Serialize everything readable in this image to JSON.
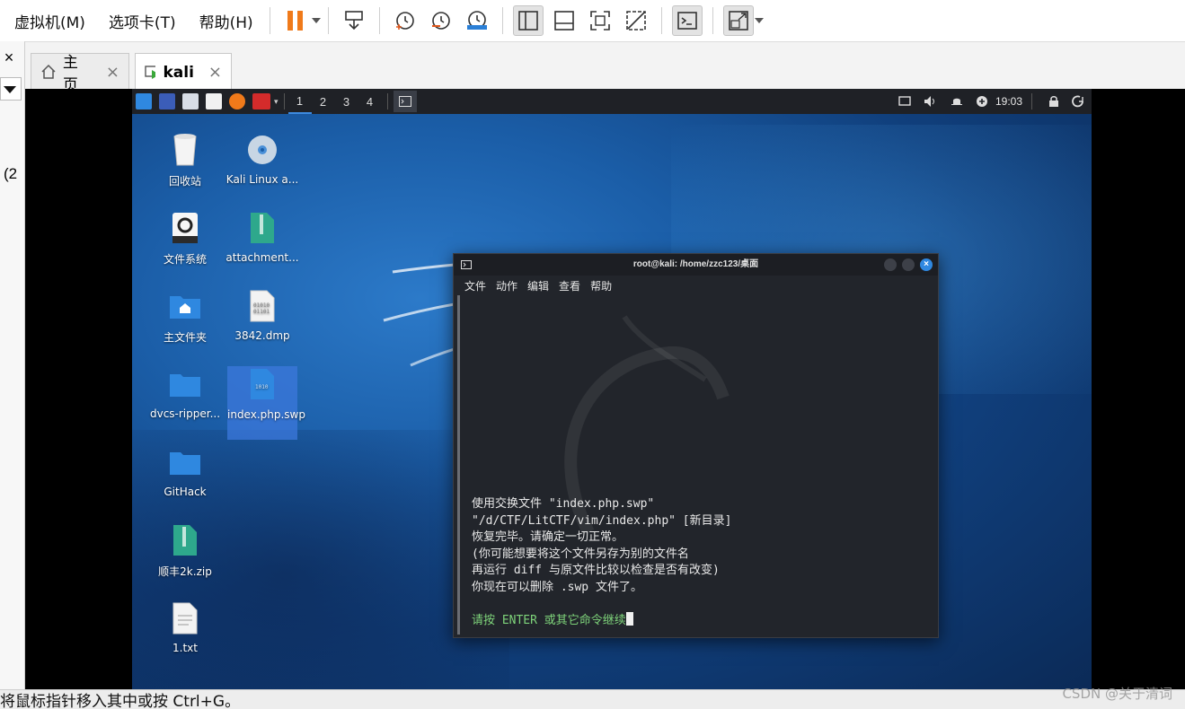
{
  "menubar": {
    "items": [
      "虚拟机(M)",
      "选项卡(T)",
      "帮助(H)"
    ]
  },
  "tabs": [
    {
      "label": "主页",
      "close": "×"
    },
    {
      "label": "kali",
      "close": "×"
    }
  ],
  "left_panel": {
    "close": "×",
    "partial": "(2"
  },
  "kali_panel": {
    "workspaces": [
      "1",
      "2",
      "3",
      "4"
    ],
    "clock": "19:03"
  },
  "desktop_icons": [
    {
      "label": "回收站"
    },
    {
      "label": "Kali Linux a..."
    },
    {
      "label": "文件系统"
    },
    {
      "label": "attachment..."
    },
    {
      "label": "主文件夹"
    },
    {
      "label": "3842.dmp"
    },
    {
      "label": "dvcs-ripper..."
    },
    {
      "label": "index.php.swp"
    },
    {
      "label": "GitHack"
    },
    {
      "label": "顺丰2k.zip"
    },
    {
      "label": "1.txt"
    }
  ],
  "terminal": {
    "title": "root@kali: /home/zzc123/桌面",
    "menu": [
      "文件",
      "动作",
      "编辑",
      "查看",
      "帮助"
    ],
    "lines": [
      "使用交换文件 \"index.php.swp\"",
      "\"/d/CTF/LitCTF/vim/index.php\" [新目录]",
      "恢复完毕。请确定一切正常。",
      "(你可能想要将这个文件另存为别的文件名",
      "再运行 diff 与原文件比较以检查是否有改变)",
      "你现在可以删除 .swp 文件了。"
    ],
    "prompt": "请按 ENTER 或其它命令继续"
  },
  "status_bar": {
    "text": "将鼠标指针移入其中或按 Ctrl+G。"
  },
  "watermark": "CSDN @关于清词",
  "colors": {
    "accent": "#3d8be0",
    "pause": "#f07a1a",
    "terminal_bg": "#22252b",
    "prompt_green": "#7ed37a"
  }
}
